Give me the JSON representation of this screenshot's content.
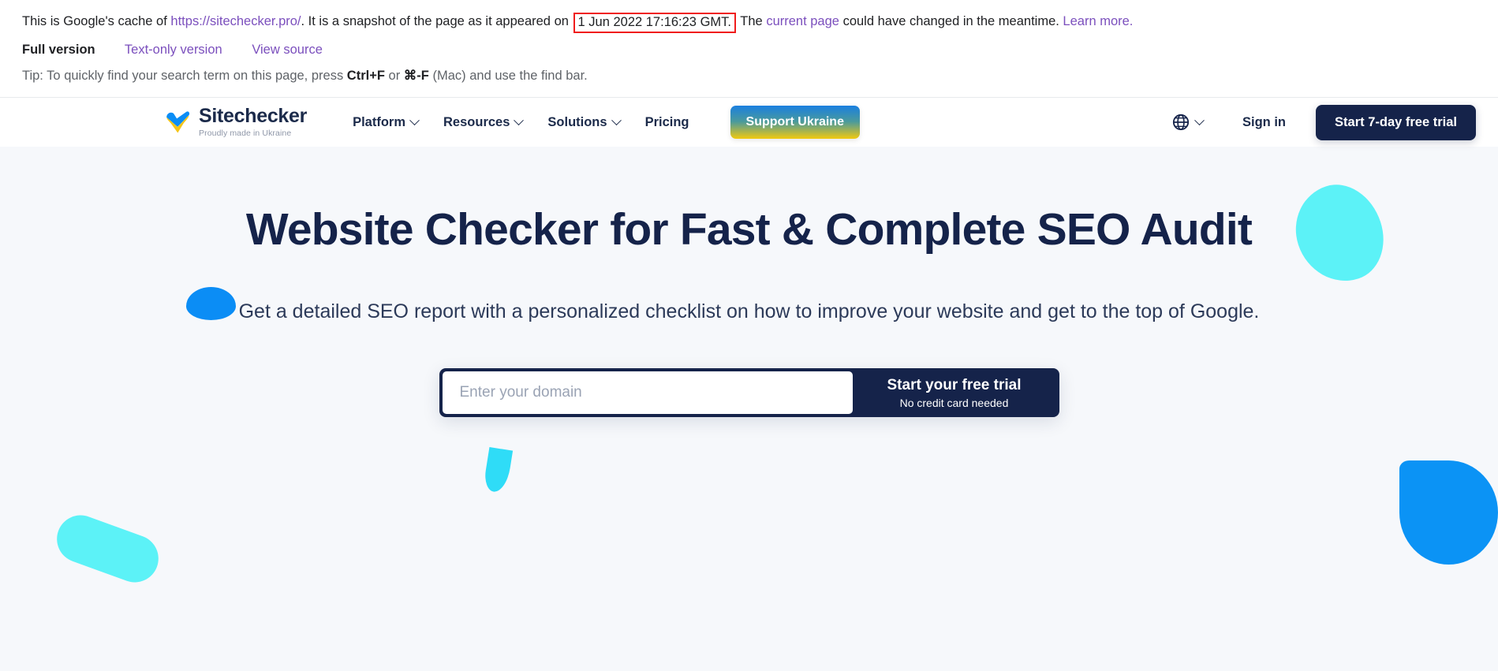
{
  "cache_banner": {
    "intro": "This is Google's cache of",
    "cached_url": "https://sitechecker.pro/",
    "after_url": ". It is a snapshot of the page as it appeared on",
    "snapshot_date": "1 Jun 2022 17:16:23 GMT.",
    "after_date": "The",
    "current_page_link": "current page",
    "tail": "could have changed in the meantime.",
    "learn_more": "Learn more.",
    "full_version": "Full version",
    "text_only_version": "Text-only version",
    "view_source": "View source",
    "tip_prefix": "Tip: To quickly find your search term on this page, press",
    "tip_key_win": "Ctrl+F",
    "tip_or": "or",
    "tip_key_mac": "⌘-F",
    "tip_suffix": "(Mac) and use the find bar.",
    "highlight_color": "#f01c1c",
    "link_color": "#7b4fbd"
  },
  "nav": {
    "logo_word": "Sitechecker",
    "logo_tagline": "Proudly made in Ukraine",
    "logo_icon": "ukraine-heart-check-icon",
    "items": [
      {
        "label": "Platform",
        "has_dropdown": true
      },
      {
        "label": "Resources",
        "has_dropdown": true
      },
      {
        "label": "Solutions",
        "has_dropdown": true
      },
      {
        "label": "Pricing",
        "has_dropdown": false
      }
    ],
    "support_ukraine_label": "Support Ukraine",
    "language_icon": "globe-icon",
    "sign_in_label": "Sign in",
    "trial_button_label": "Start 7-day free trial",
    "colors": {
      "navy": "#15234a",
      "gradient_top": "#1a7fe0",
      "gradient_bottom": "#f2c90f"
    }
  },
  "hero": {
    "title": "Website Checker for Fast & Complete SEO Audit",
    "subtitle": "Get a detailed SEO report with a personalized checklist on how to improve your website and get to the top of Google.",
    "input_placeholder": "Enter your domain",
    "input_value": "",
    "submit_primary": "Start your free trial",
    "submit_secondary": "No credit card needed",
    "background_color": "#f6f8fb",
    "decor_colors": {
      "cyan": "#5cf2f7",
      "blue": "#0b93f5",
      "bright_cyan": "#2fdcf7"
    }
  }
}
